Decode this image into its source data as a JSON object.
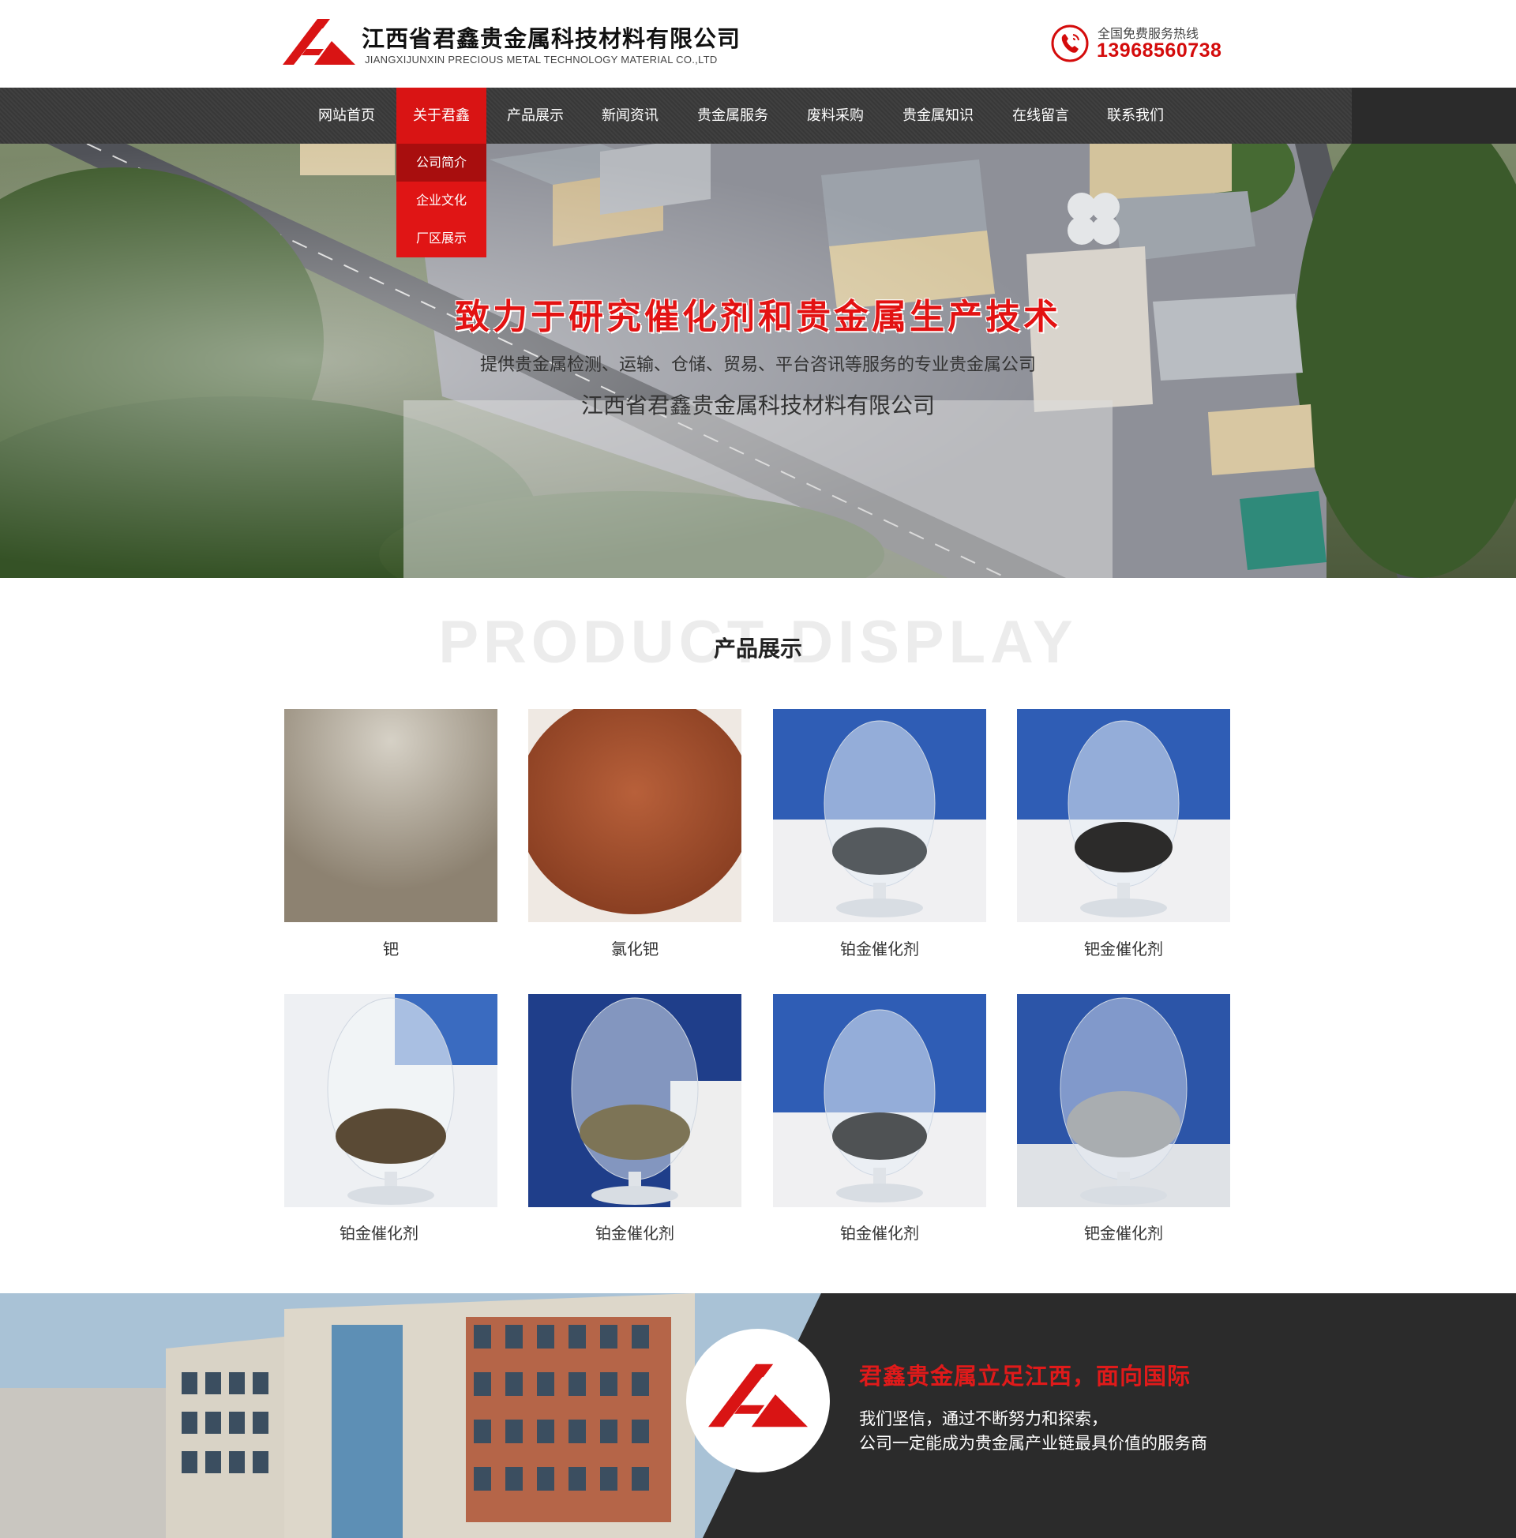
{
  "header": {
    "company_cn": "江西省君鑫贵金属科技材料有限公司",
    "company_en": "JIANGXIJUNXIN PRECIOUS METAL TECHNOLOGY MATERIAL CO.,LTD",
    "hotline_label": "全国免费服务热线",
    "hotline_number": "13968560738",
    "logo_icon": "junxin-logo",
    "phone_icon": "phone-icon"
  },
  "nav": {
    "items": [
      {
        "label": "网站首页"
      },
      {
        "label": "关于君鑫",
        "active": true
      },
      {
        "label": "产品展示"
      },
      {
        "label": "新闻资讯"
      },
      {
        "label": "贵金属服务"
      },
      {
        "label": "废料采购"
      },
      {
        "label": "贵金属知识"
      },
      {
        "label": "在线留言"
      },
      {
        "label": "联系我们"
      }
    ],
    "dropdown": [
      {
        "label": "公司简介",
        "active": true
      },
      {
        "label": "企业文化"
      },
      {
        "label": "厂区展示"
      }
    ]
  },
  "banner": {
    "headline": "致力于研究催化剂和贵金属生产技术",
    "subtitle": "提供贵金属检测、运输、仓储、贸易、平台咨讯等服务的专业贵金属公司",
    "company": "江西省君鑫贵金属科技材料有限公司"
  },
  "products": {
    "bg_title": "PRODUCT DISPLAY",
    "title": "产品展示",
    "items": [
      {
        "name": "钯"
      },
      {
        "name": "氯化钯"
      },
      {
        "name": "铂金催化剂"
      },
      {
        "name": "钯金催化剂"
      },
      {
        "name": "铂金催化剂"
      },
      {
        "name": "铂金催化剂"
      },
      {
        "name": "铂金催化剂"
      },
      {
        "name": "钯金催化剂"
      }
    ]
  },
  "about": {
    "title": "君鑫贵金属立足江西，面向国际",
    "line1": "我们坚信，通过不断努力和探索，",
    "line2": "公司一定能成为贵金属产业链最具价值的服务商"
  },
  "colors": {
    "brand_red": "#d91414",
    "nav_bg": "#3a3a3a",
    "hotline_red": "#d40b0b"
  }
}
